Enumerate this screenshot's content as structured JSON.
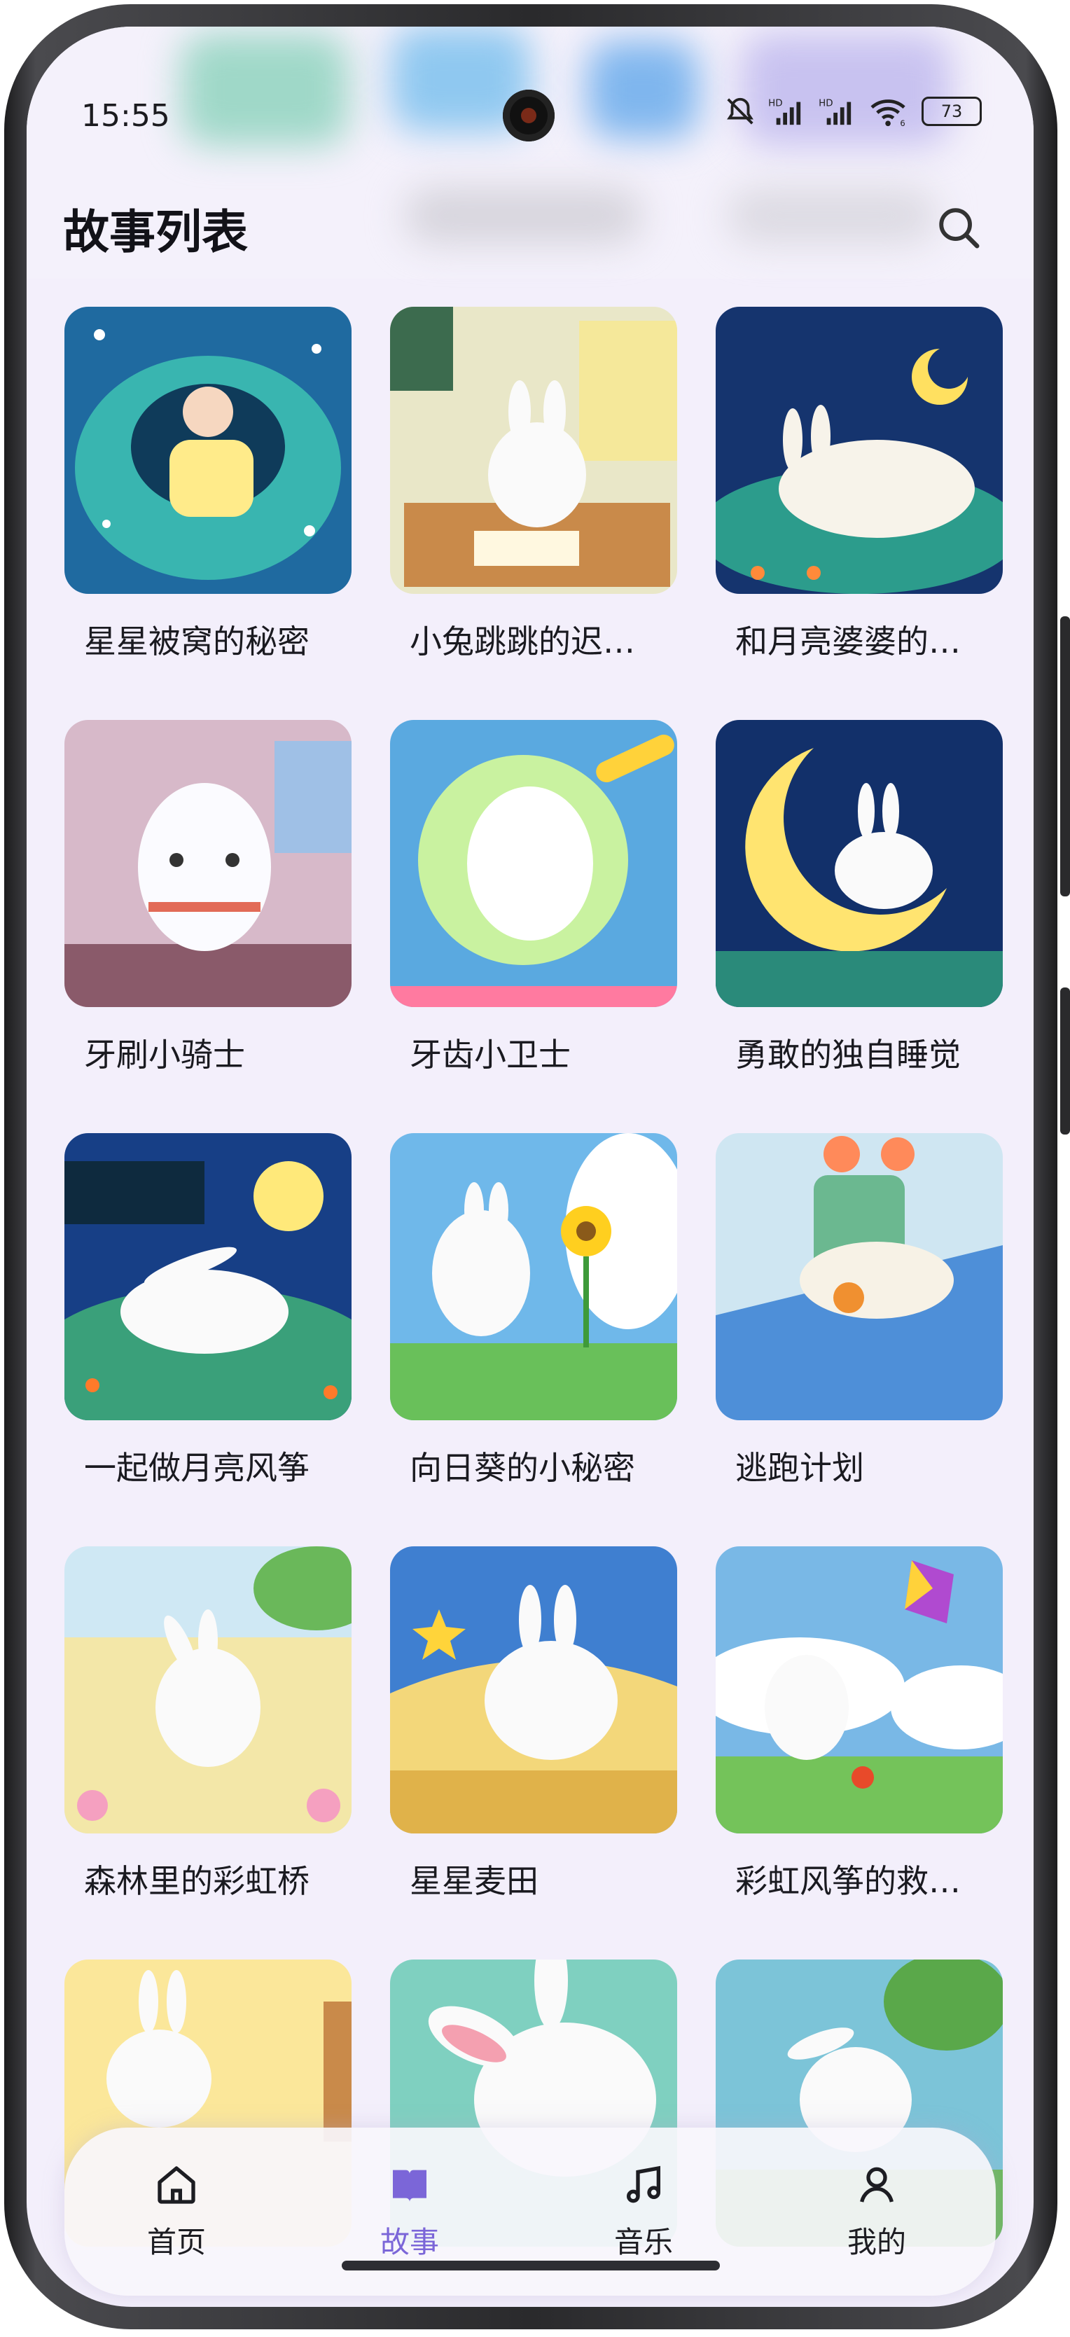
{
  "status_bar": {
    "time": "15:55",
    "battery": "73",
    "network_labels": [
      "HD",
      "HD"
    ],
    "wifi_badge": "6"
  },
  "header": {
    "title": "故事列表",
    "search_icon": "search-icon"
  },
  "stories": [
    {
      "title": "星星被窝的秘密"
    },
    {
      "title": "小兔跳跳的迟…"
    },
    {
      "title": "和月亮婆婆的…"
    },
    {
      "title": "牙刷小骑士"
    },
    {
      "title": "牙齿小卫士"
    },
    {
      "title": "勇敢的独自睡觉"
    },
    {
      "title": "一起做月亮风筝"
    },
    {
      "title": "向日葵的小秘密"
    },
    {
      "title": "逃跑计划"
    },
    {
      "title": "森林里的彩虹桥"
    },
    {
      "title": "星星麦田"
    },
    {
      "title": "彩虹风筝的救…"
    },
    {
      "title": ""
    },
    {
      "title": ""
    },
    {
      "title": ""
    }
  ],
  "bottom_nav": {
    "items": [
      {
        "label": "首页",
        "icon": "home-icon"
      },
      {
        "label": "故事",
        "icon": "book-icon"
      },
      {
        "label": "音乐",
        "icon": "music-note-icon"
      },
      {
        "label": "我的",
        "icon": "person-icon"
      }
    ],
    "active_index": 1
  },
  "colors": {
    "accent": "#7b66d8",
    "background": "#f3effb"
  }
}
